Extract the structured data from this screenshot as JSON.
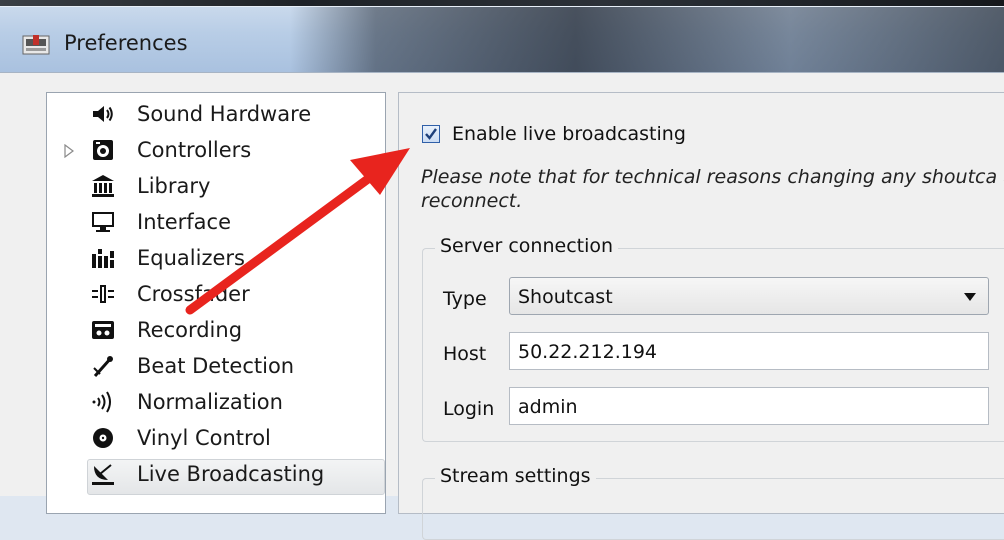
{
  "window": {
    "title": "Preferences",
    "icon": "mixer-app-icon"
  },
  "sidebar": {
    "items": [
      {
        "label": "Sound Hardware",
        "icon": "speaker-icon",
        "expandable": false,
        "selected": false
      },
      {
        "label": "Controllers",
        "icon": "controller-icon",
        "expandable": true,
        "selected": false
      },
      {
        "label": "Library",
        "icon": "library-icon",
        "expandable": false,
        "selected": false
      },
      {
        "label": "Interface",
        "icon": "monitor-icon",
        "expandable": false,
        "selected": false
      },
      {
        "label": "Equalizers",
        "icon": "equalizer-icon",
        "expandable": false,
        "selected": false
      },
      {
        "label": "Crossfader",
        "icon": "crossfader-icon",
        "expandable": false,
        "selected": false
      },
      {
        "label": "Recording",
        "icon": "recording-icon",
        "expandable": false,
        "selected": false
      },
      {
        "label": "Beat Detection",
        "icon": "beat-detection-icon",
        "expandable": false,
        "selected": false
      },
      {
        "label": "Normalization",
        "icon": "normalization-icon",
        "expandable": false,
        "selected": false
      },
      {
        "label": "Vinyl Control",
        "icon": "vinyl-icon",
        "expandable": false,
        "selected": false
      },
      {
        "label": "Live Broadcasting",
        "icon": "satellite-dish-icon",
        "expandable": false,
        "selected": true
      }
    ]
  },
  "main": {
    "enable_broadcasting": {
      "label": "Enable live broadcasting",
      "checked": true
    },
    "note": "Please note that for technical reasons changing any shoutca and reconnect.",
    "server_connection": {
      "title": "Server connection",
      "type_label": "Type",
      "type_value": "Shoutcast",
      "host_label": "Host",
      "host_value": "50.22.212.194",
      "login_label": "Login",
      "login_value": "admin"
    },
    "stream_settings": {
      "title": "Stream settings"
    }
  },
  "colors": {
    "annotation_arrow": "#e8241e",
    "checkbox_accent": "#2f5fa8",
    "selected_item_bg": "#e4e6e8"
  }
}
